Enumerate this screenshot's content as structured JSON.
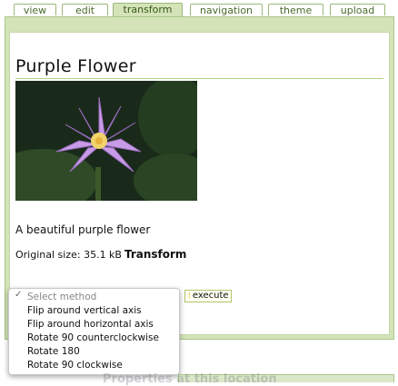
{
  "tabs": [
    {
      "label": "view"
    },
    {
      "label": "edit"
    },
    {
      "label": "transform",
      "active": true
    },
    {
      "label": "navigation"
    },
    {
      "label": "theme"
    },
    {
      "label": "upload"
    }
  ],
  "page": {
    "title": "Purple Flower",
    "description": "A beautiful purple flower",
    "size_label": "Original size: 35.1 kB",
    "transform_label": "Transform"
  },
  "form": {
    "execute_label": "execute",
    "select_placeholder": "Select method",
    "options": [
      "Flip around vertical axis",
      "Flip around horizontal axis",
      "Rotate 90 counterclockwise",
      "Rotate 180",
      "Rotate 90 clockwise"
    ]
  },
  "footer": {
    "partial_text": "Properties at this location"
  },
  "colors": {
    "tab_active": "#d4e4b8",
    "panel": "#d4e4b8",
    "border": "#a9c48a"
  }
}
